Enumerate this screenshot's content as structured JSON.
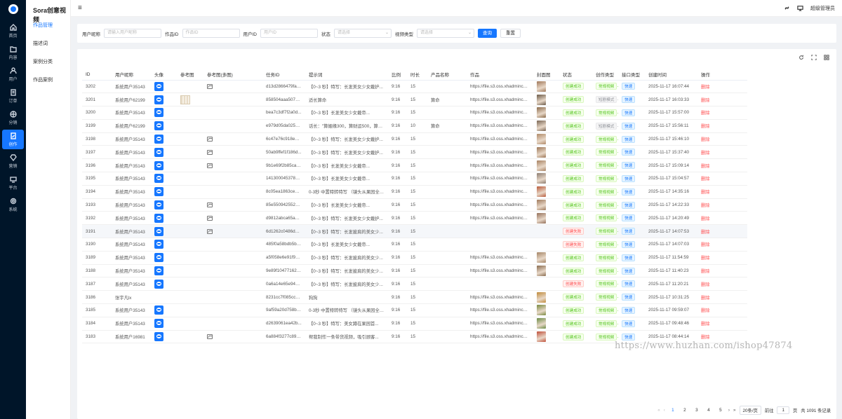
{
  "app": {
    "title": "Sora创意视频"
  },
  "rail": {
    "items": [
      {
        "label": "首页",
        "icon": "home-icon"
      },
      {
        "label": "内容",
        "icon": "folder-icon"
      },
      {
        "label": "用户",
        "icon": "user-icon"
      },
      {
        "label": "订单",
        "icon": "order-icon"
      },
      {
        "label": "分销",
        "icon": "distribution-icon"
      },
      {
        "label": "创作",
        "icon": "create-icon",
        "active": true
      },
      {
        "label": "营销",
        "icon": "diamond-icon"
      },
      {
        "label": "平台",
        "icon": "monitor-icon"
      },
      {
        "label": "系统",
        "icon": "gear-icon"
      }
    ]
  },
  "submenu": {
    "items": [
      {
        "label": "作品管理",
        "active": true
      },
      {
        "label": "描述词"
      },
      {
        "label": "案例分类"
      },
      {
        "label": "作品案例"
      }
    ]
  },
  "topbar": {
    "user": "超级管理员"
  },
  "filters": {
    "user_nick": {
      "label": "用户昵称",
      "placeholder": "请输入用户昵称"
    },
    "work_id": {
      "label": "作品ID",
      "placeholder": "作品ID"
    },
    "user_id": {
      "label": "用户ID",
      "placeholder": "用户ID"
    },
    "status": {
      "label": "状态",
      "placeholder": "请选择"
    },
    "video_type": {
      "label": "视频类型",
      "placeholder": "请选择"
    },
    "search_btn": "查询",
    "reset_btn": "重置"
  },
  "table": {
    "columns": [
      "ID",
      "用户昵称",
      "头像",
      "参考图",
      "参考图(多图)",
      "任务ID",
      "提示词",
      "比例",
      "时长",
      "产品名称",
      "作品",
      "封面图",
      "状态",
      "创作类型",
      "接口类型",
      "创建时间",
      "操作"
    ],
    "rows": [
      {
        "id": "3202",
        "nick": "系统用户35143",
        "avatar": true,
        "ref": false,
        "multi": true,
        "task": "d13d2866479fa5...",
        "prompt": "【0~3 秒】特写：长发美女少女戴护...",
        "ratio": "9:16",
        "dur": "15",
        "product": "",
        "work": "https://file.s3.oss.xhadmincn.clou",
        "cover": "#a0785a",
        "status": "创建成功",
        "ok": true,
        "mode": "常规视频",
        "api": "快速",
        "time": "2025-11-17 16:07:44",
        "op": "删除"
      },
      {
        "id": "3201",
        "nick": "系统用户62199",
        "avatar": true,
        "ref": true,
        "multi": false,
        "task": "858504aaa50751...",
        "prompt": "适长算命",
        "ratio": "9:16",
        "dur": "15",
        "product": "算命",
        "work": "https://file.s3.oss.xhadmincn.clou",
        "cover": "#6b5a48",
        "status": "创建成功",
        "ok": true,
        "mode": "短剧模式",
        "api": "快速",
        "time": "2025-11-17 16:03:33",
        "op": "删除"
      },
      {
        "id": "3200",
        "nick": "系统用户35143",
        "avatar": true,
        "ref": false,
        "multi": false,
        "task": "bea7c3df7f2a0d...",
        "prompt": "【0~3 秒】长发美女少女戴帝...",
        "ratio": "9:16",
        "dur": "15",
        "product": "",
        "work": "https://file.s3.oss.xhadmincn.clou",
        "cover": "#8a6a4a",
        "status": "创建成功",
        "ok": true,
        "mode": "常规视频",
        "api": "快速",
        "time": "2025-11-17 15:57:00",
        "op": "删除"
      },
      {
        "id": "3199",
        "nick": "系统用户62199",
        "avatar": true,
        "ref": false,
        "multi": false,
        "task": "e979d05da0256c...",
        "prompt": "话长：\"算姻缘300，算财运500，算生...",
        "ratio": "9:16",
        "dur": "10",
        "product": "算命",
        "work": "https://file.s3.oss.xhadmincn.clou",
        "cover": "#7a6654",
        "status": "创建成功",
        "ok": true,
        "mode": "短剧模式",
        "api": "快速",
        "time": "2025-11-17 15:56:11",
        "op": "删除"
      },
      {
        "id": "3198",
        "nick": "系统用户35143",
        "avatar": true,
        "ref": false,
        "multi": true,
        "task": "6c47e76c918e58...",
        "prompt": "【0~3 秒】特写：长发美女少女戴护...",
        "ratio": "9:16",
        "dur": "15",
        "product": "",
        "work": "https://file.s3.oss.xhadmincn.clou",
        "cover": "#b08a68",
        "status": "创建成功",
        "ok": true,
        "mode": "常规视频",
        "api": "快速",
        "time": "2025-11-17 15:46:10",
        "op": "删除"
      },
      {
        "id": "3197",
        "nick": "系统用户35143",
        "avatar": true,
        "ref": false,
        "multi": true,
        "task": "50ab9ffef1f186d...",
        "prompt": "【0~3 秒】特写：长发美女少女戴护...",
        "ratio": "9:16",
        "dur": "15",
        "product": "",
        "work": "https://file.s3.oss.xhadmincn.clou",
        "cover": "#9c7656",
        "status": "创建成功",
        "ok": true,
        "mode": "常规视频",
        "api": "快速",
        "time": "2025-11-17 15:37:40",
        "op": "删除"
      },
      {
        "id": "3196",
        "nick": "系统用户35143",
        "avatar": true,
        "ref": false,
        "multi": true,
        "task": "9b1e69f2b85ca1...",
        "prompt": "【0~3 秒】长发美女少女戴帝...",
        "ratio": "9:16",
        "dur": "15",
        "product": "",
        "work": "https://file.s3.oss.xhadmincn.clou",
        "cover": "#a88262",
        "status": "创建成功",
        "ok": true,
        "mode": "常规视频",
        "api": "快速",
        "time": "2025-11-17 15:09:14",
        "op": "删除"
      },
      {
        "id": "3195",
        "nick": "系统用户35143",
        "avatar": true,
        "ref": false,
        "multi": false,
        "task": "14130004537808...",
        "prompt": "【0~3 秒】长发美女少女戴帝...",
        "ratio": "9:16",
        "dur": "15",
        "product": "",
        "work": "https://file.s3.oss.xhadmincn.clou",
        "cover": "#8c7c70",
        "status": "创建成功",
        "ok": true,
        "mode": "常规视频",
        "api": "快速",
        "time": "2025-11-17 15:04:57",
        "op": "删除"
      },
      {
        "id": "3194",
        "nick": "系统用户35143",
        "avatar": true,
        "ref": false,
        "multi": false,
        "task": "8c05ea1863ce4c...",
        "prompt": "0-3秒 中置特转特写 （镜头从果园全景...",
        "ratio": "9:16",
        "dur": "15",
        "product": "",
        "work": "https://file.s3.oss.xhadmincn.clou",
        "cover": "#b85a3a",
        "status": "创建成功",
        "ok": true,
        "mode": "常规视频",
        "api": "快速",
        "time": "2025-11-17 14:35:16",
        "op": "删除"
      },
      {
        "id": "3193",
        "nick": "系统用户35143",
        "avatar": true,
        "ref": false,
        "multi": true,
        "task": "85e55094255298...",
        "prompt": "【0~3 秒】长发美女少女戴帝...",
        "ratio": "9:16",
        "dur": "15",
        "product": "",
        "work": "https://file.s3.oss.xhadmincn.clou",
        "cover": "#a07a5c",
        "status": "创建成功",
        "ok": true,
        "mode": "常规视频",
        "api": "快速",
        "time": "2025-11-17 14:22:33",
        "op": "删除"
      },
      {
        "id": "3192",
        "nick": "系统用户35143",
        "avatar": true,
        "ref": false,
        "multi": true,
        "task": "d9812abca65a4d...",
        "prompt": "【0~3 秒】特写：长发美女少女戴护...",
        "ratio": "9:16",
        "dur": "15",
        "product": "",
        "work": "https://file.s3.oss.xhadmincn.clou",
        "cover": "#94705a",
        "status": "创建成功",
        "ok": true,
        "mode": "常规视频",
        "api": "快速",
        "time": "2025-11-17 14:20:49",
        "op": "删除"
      },
      {
        "id": "3191",
        "nick": "系统用户35143",
        "avatar": true,
        "ref": false,
        "multi": true,
        "task": "6d1262c0486d03...",
        "prompt": "【0~3 秒】特写：长发披肩的美女少...",
        "ratio": "9:16",
        "dur": "15",
        "product": "",
        "work": "",
        "cover": "",
        "status": "创建失败",
        "ok": false,
        "mode": "常规视频",
        "api": "快速",
        "time": "2025-11-17 14:07:53",
        "op": "删除",
        "hl": true
      },
      {
        "id": "3190",
        "nick": "系统用户35143",
        "avatar": true,
        "ref": false,
        "multi": false,
        "task": "485f0a58bdb5b4...",
        "prompt": "【0~3 秒】长发美女少女戴帝...",
        "ratio": "9:16",
        "dur": "15",
        "product": "",
        "work": "",
        "cover": "",
        "status": "创建失败",
        "ok": false,
        "mode": "常规视频",
        "api": "快速",
        "time": "2025-11-17 14:07:03",
        "op": "删除"
      },
      {
        "id": "3189",
        "nick": "系统用户35143",
        "avatar": true,
        "ref": false,
        "multi": false,
        "task": "a5f058e6e91f9c0...",
        "prompt": "【0~3 秒】特写：长发披肩的美女少...",
        "ratio": "9:16",
        "dur": "15",
        "product": "",
        "work": "https://file.s3.oss.xhadmincn.clou",
        "cover": "#a48466",
        "status": "创建成功",
        "ok": true,
        "mode": "常规视频",
        "api": "快速",
        "time": "2025-11-17 11:54:59",
        "op": "删除"
      },
      {
        "id": "3188",
        "nick": "系统用户35143",
        "avatar": true,
        "ref": false,
        "multi": false,
        "task": "9e89f1047716​20...",
        "prompt": "【0~3 秒】特写：长发披肩的美女少...",
        "ratio": "9:16",
        "dur": "15",
        "product": "",
        "work": "https://file.s3.oss.xhadmincn.clou",
        "cover": "#8a6c50",
        "status": "创建成功",
        "ok": true,
        "mode": "常规视频",
        "api": "快速",
        "time": "2025-11-17 11:40:23",
        "op": "删除"
      },
      {
        "id": "3187",
        "nick": "系统用户35143",
        "avatar": true,
        "ref": false,
        "multi": false,
        "task": "0a6a14e65e94b4...",
        "prompt": "【0~3 秒】特写：长发披肩的美女少...",
        "ratio": "9:16",
        "dur": "15",
        "product": "",
        "work": "",
        "cover": "",
        "status": "创建失败",
        "ok": false,
        "mode": "常规视频",
        "api": "快速",
        "time": "2025-11-17 11:20:21",
        "op": "删除"
      },
      {
        "id": "3186",
        "nick": "张宇凡lx",
        "avatar": false,
        "ref": false,
        "multi": false,
        "task": "8231cc7f085ccee...",
        "prompt": "狗狗",
        "ratio": "9:16",
        "dur": "15",
        "product": "",
        "work": "https://file.s3.oss.xhadmincn.clou",
        "cover": "#c08a3a",
        "status": "创建成功",
        "ok": true,
        "mode": "常规视频",
        "api": "快速",
        "time": "2025-11-17 10:31:25",
        "op": "删除"
      },
      {
        "id": "3185",
        "nick": "系统用户35143",
        "avatar": true,
        "ref": false,
        "multi": false,
        "task": "9af59a20d758bb...",
        "prompt": "0-3秒 中置特转特写 （镜头从果园全景...",
        "ratio": "9:16",
        "dur": "15",
        "product": "",
        "work": "https://file.s3.oss.xhadmincn.clou",
        "cover": "#7a8a40",
        "status": "创建成功",
        "ok": true,
        "mode": "常规视频",
        "api": "快速",
        "time": "2025-11-17 09:59:07",
        "op": "删除"
      },
      {
        "id": "3184",
        "nick": "系统用户35143",
        "avatar": true,
        "ref": false,
        "multi": false,
        "task": "d2639061ea42b...",
        "prompt": "【0~3 秒】特写：美女蹲在果园首...",
        "ratio": "9:16",
        "dur": "15",
        "product": "",
        "work": "https://file.s3.oss.xhadmincn.clou",
        "cover": "#6a8a44",
        "status": "创建成功",
        "ok": true,
        "mode": "常规视频",
        "api": "快速",
        "time": "2025-11-17 09:48:46",
        "op": "删除"
      },
      {
        "id": "3183",
        "nick": "系统用户16981",
        "avatar": true,
        "ref": false,
        "multi": true,
        "task": "6a884f3277c899...",
        "prompt": "帮我制作一条带货视频，吸引顾客...",
        "ratio": "9:16",
        "dur": "15",
        "product": "",
        "work": "https://file.s3.oss.xhadmincn.clou",
        "cover": "#c0503a",
        "status": "创建成功",
        "ok": true,
        "mode": "常规视频",
        "api": "快速",
        "time": "2025-11-17 08:44:14",
        "op": "删除"
      }
    ]
  },
  "pager": {
    "pages": [
      "1",
      "2",
      "3",
      "4",
      "5"
    ],
    "current": "1",
    "size": "20条/页",
    "jump_label": "前往",
    "jump_value": "1",
    "unit": "页",
    "total": "共 1091 条记录"
  },
  "watermark": "https://www.huzhan.com/ishop47874"
}
